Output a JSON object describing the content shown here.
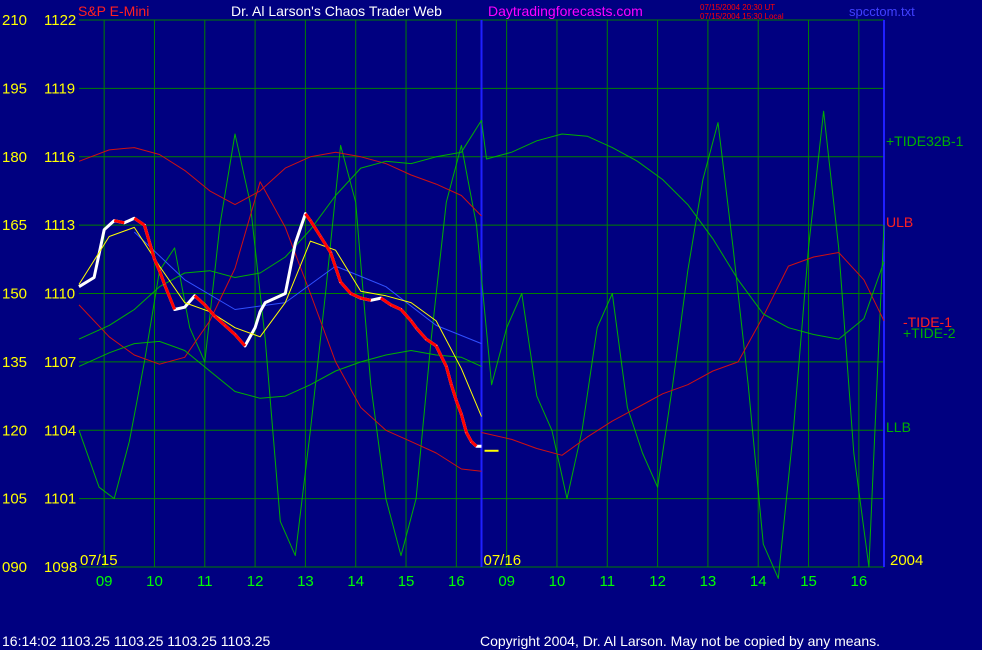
{
  "header": {
    "symbol": "S&P E-Mini",
    "title": "Dr. Al Larson's Chaos Trader Web",
    "site": "Daytradingforecasts.com",
    "timestamp_ut": "07/15/2004 20:30 UT",
    "timestamp_local": "07/15/2004 15:30 Local",
    "filename": "spcctom.txt"
  },
  "footer": {
    "status": "16:14:02  1103.25 1103.25 1103.25 1103.25",
    "copyright": "Copyright 2004, Dr. Al Larson. May not be copied by any means."
  },
  "colors": {
    "background": "#000080",
    "grid": "#008000",
    "price_up": "#ffffff",
    "price_down": "#ff0000",
    "tide_green": "#00b000",
    "band_red": "#d01010",
    "average_yellow": "#ffff00",
    "axis_label": "#ffff00",
    "time_label": "#00ff00",
    "title_text": "#ffffff",
    "site_text": "#ff00ff",
    "file_text": "#4040ff",
    "divider": "#2020ff"
  },
  "chart_data": {
    "type": "line",
    "title": "S&P E-Mini",
    "y_left_labels": [
      "210",
      "195",
      "180",
      "165",
      "150",
      "135",
      "120",
      "105",
      "090"
    ],
    "y_right_labels": [
      "1122",
      "1119",
      "1116",
      "1113",
      "1110",
      "1107",
      "1104",
      "1101",
      "1098"
    ],
    "ylim_price": [
      1098,
      1122
    ],
    "ylim_index": [
      90,
      210
    ],
    "x_hours": [
      "09",
      "10",
      "11",
      "12",
      "13",
      "14",
      "15",
      "16",
      "09",
      "10",
      "11",
      "12",
      "13",
      "14",
      "15",
      "16"
    ],
    "dates": [
      "07/15",
      "07/16"
    ],
    "year": "2004",
    "xlim": [
      8.4,
      24.4
    ],
    "day_divider_x": 16.4,
    "series": [
      {
        "name": "+TIDE32B-1",
        "label": "+TIDE32B-1",
        "color": "#00b000",
        "x": [
          8.4,
          9.0,
          9.5,
          10.0,
          10.5,
          11.0,
          11.5,
          12.0,
          12.5,
          13.0,
          13.5,
          14.0,
          14.5,
          15.0,
          15.5,
          16.0,
          16.4,
          16.5,
          17.0,
          17.5,
          18.0,
          18.5,
          19.0,
          19.5,
          20.0,
          20.5,
          21.0,
          21.5,
          22.0,
          22.5,
          23.0,
          23.5,
          24.0,
          24.4
        ],
        "y": [
          1108.0,
          1108.6,
          1109.3,
          1110.3,
          1110.9,
          1111.0,
          1110.7,
          1110.9,
          1111.6,
          1112.8,
          1114.3,
          1115.5,
          1115.8,
          1115.7,
          1116.0,
          1116.2,
          1117.6,
          1115.9,
          1116.2,
          1116.7,
          1117.0,
          1116.9,
          1116.4,
          1115.8,
          1115.0,
          1113.9,
          1112.4,
          1110.6,
          1109.1,
          1108.5,
          1108.2,
          1108.0,
          1108.9,
          1111.4
        ]
      },
      {
        "name": "ULB",
        "label": "ULB",
        "color": "#d01010",
        "x": [
          8.4,
          9.0,
          9.5,
          10.0,
          10.5,
          11.0,
          11.5,
          12.0,
          12.5,
          13.0,
          13.5,
          14.0,
          14.5,
          15.0,
          15.5,
          16.0,
          16.4
        ],
        "y": [
          1115.8,
          1116.3,
          1116.4,
          1116.1,
          1115.4,
          1114.5,
          1113.9,
          1114.5,
          1115.5,
          1116.0,
          1116.2,
          1116.0,
          1115.7,
          1115.2,
          1114.8,
          1114.3,
          1113.4
        ]
      },
      {
        "name": "LLB",
        "label": "LLB",
        "color": "#d01010",
        "x": [
          8.4,
          9.0,
          9.5,
          10.0,
          10.5,
          11.0,
          11.5,
          12.0,
          12.5,
          13.0,
          13.5,
          14.0,
          14.5,
          15.0,
          15.5,
          16.0,
          16.4
        ],
        "y": [
          1109.5,
          1108.1,
          1107.3,
          1106.9,
          1107.2,
          1108.8,
          1111.1,
          1114.9,
          1112.9,
          1110.0,
          1107.0,
          1105.0,
          1104.0,
          1103.5,
          1103.0,
          1102.3,
          1102.2
        ]
      },
      {
        "name": "-TIDE-1",
        "label": "-TIDE-1",
        "color": "#d01010",
        "x": [
          16.4,
          17.0,
          17.5,
          18.0,
          18.5,
          19.0,
          19.5,
          20.0,
          20.5,
          21.0,
          21.5,
          22.0,
          22.5,
          23.0,
          23.5,
          24.0,
          24.4
        ],
        "y": [
          1103.9,
          1103.6,
          1103.2,
          1102.9,
          1103.7,
          1104.4,
          1105.0,
          1105.6,
          1106.0,
          1106.6,
          1107.0,
          1109.0,
          1111.2,
          1111.6,
          1111.8,
          1110.6,
          1108.8
        ]
      },
      {
        "name": "+TIDE-2",
        "label": "+TIDE-2",
        "color": "#00b000",
        "x": [
          8.4,
          9.0,
          9.5,
          10.0,
          10.5,
          11.0,
          11.5,
          12.0,
          12.5,
          13.0,
          13.5,
          14.0,
          14.5,
          15.0,
          15.5,
          16.0,
          16.4
        ],
        "y": [
          1106.8,
          1107.4,
          1107.8,
          1107.9,
          1107.5,
          1106.6,
          1105.7,
          1105.4,
          1105.5,
          1106.0,
          1106.6,
          1107.0,
          1107.3,
          1107.5,
          1107.3,
          1107.2,
          1106.8
        ]
      },
      {
        "name": "TIDE-OSC",
        "label": "",
        "color": "#00b000",
        "x": [
          8.4,
          8.8,
          9.1,
          9.4,
          9.7,
          10.0,
          10.3,
          10.6,
          10.9,
          11.2,
          11.5,
          11.8,
          12.1,
          12.4,
          12.7,
          13.0,
          13.3,
          13.6,
          13.9,
          14.2,
          14.5,
          14.8,
          15.1,
          15.4,
          15.7,
          16.0,
          16.3,
          16.6,
          16.9,
          17.2,
          17.5,
          17.8,
          18.1,
          18.4,
          18.7,
          19.0,
          19.3,
          19.6,
          19.9,
          20.2,
          20.5,
          20.8,
          21.1,
          21.4,
          21.7,
          22.0,
          22.3,
          22.6,
          22.9,
          23.2,
          23.5,
          23.8,
          24.1,
          24.4
        ],
        "y": [
          1104.0,
          1101.5,
          1101.0,
          1103.5,
          1107.0,
          1111.0,
          1112.0,
          1108.5,
          1107.0,
          1113.0,
          1117.0,
          1114.0,
          1108.0,
          1100.0,
          1098.5,
          1104.0,
          1110.0,
          1116.5,
          1114.0,
          1106.0,
          1101.0,
          1098.5,
          1101.0,
          1108.0,
          1114.0,
          1116.5,
          1113.0,
          1106.0,
          1108.5,
          1110.0,
          1105.5,
          1104.0,
          1101.0,
          1104.0,
          1108.5,
          1110.0,
          1105.0,
          1103.0,
          1101.5,
          1106.0,
          1111.0,
          1115.0,
          1117.5,
          1112.0,
          1106.0,
          1099.0,
          1097.5,
          1104.0,
          1112.0,
          1118.0,
          1112.0,
          1103.0,
          1098.0,
          1113.0
        ]
      },
      {
        "name": "SP-E-Mini-Price",
        "label": "",
        "color": "#ffffff",
        "x": [
          8.4,
          8.7,
          8.9,
          9.1,
          9.3,
          9.5,
          9.7,
          9.9,
          10.0,
          10.1,
          10.3,
          10.5,
          10.7,
          10.9,
          11.1,
          11.3,
          11.5,
          11.7,
          11.9,
          12.0,
          12.1,
          12.3,
          12.5,
          12.7,
          12.9,
          13.0,
          13.2,
          13.4,
          13.6,
          13.8,
          14.0,
          14.2,
          14.4,
          14.6,
          14.8,
          15.0,
          15.1,
          15.3,
          15.5,
          15.7,
          15.8,
          15.9,
          16.0,
          16.1,
          16.2,
          16.3,
          16.4
        ],
        "y": [
          1110.3,
          1110.7,
          1112.8,
          1113.2,
          1113.1,
          1113.3,
          1113.0,
          1111.5,
          1111.0,
          1110.4,
          1109.3,
          1109.4,
          1109.9,
          1109.5,
          1109.0,
          1108.6,
          1108.2,
          1107.7,
          1108.5,
          1109.2,
          1109.6,
          1109.8,
          1110.0,
          1112.2,
          1113.5,
          1113.2,
          1112.5,
          1111.8,
          1110.5,
          1110.0,
          1109.8,
          1109.7,
          1109.8,
          1109.5,
          1109.3,
          1108.8,
          1108.5,
          1108.0,
          1107.7,
          1106.8,
          1106.0,
          1105.3,
          1104.7,
          1103.9,
          1103.5,
          1103.3,
          1103.3
        ]
      },
      {
        "name": "Price-Average",
        "label": "",
        "color": "#ffff00",
        "x": [
          8.4,
          9.0,
          9.5,
          10.0,
          10.5,
          11.0,
          11.5,
          12.0,
          12.5,
          13.0,
          13.5,
          14.0,
          14.5,
          15.0,
          15.5,
          16.0,
          16.4
        ],
        "y": [
          1110.4,
          1112.5,
          1112.9,
          1111.2,
          1109.6,
          1109.2,
          1108.5,
          1108.1,
          1109.6,
          1112.3,
          1111.9,
          1110.1,
          1109.9,
          1109.6,
          1108.8,
          1106.7,
          1104.6
        ]
      },
      {
        "name": "Price-Trend",
        "label": "",
        "color": "#3050ff",
        "x": [
          9.5,
          10.5,
          11.5,
          12.5,
          13.5,
          14.5,
          15.5,
          16.4
        ],
        "y": [
          1112.7,
          1110.6,
          1109.3,
          1109.6,
          1111.2,
          1110.3,
          1108.6,
          1107.8
        ]
      }
    ],
    "annotations": [
      {
        "type": "close-tick",
        "x": 16.5,
        "y": 1103.1
      }
    ],
    "grid": true
  }
}
